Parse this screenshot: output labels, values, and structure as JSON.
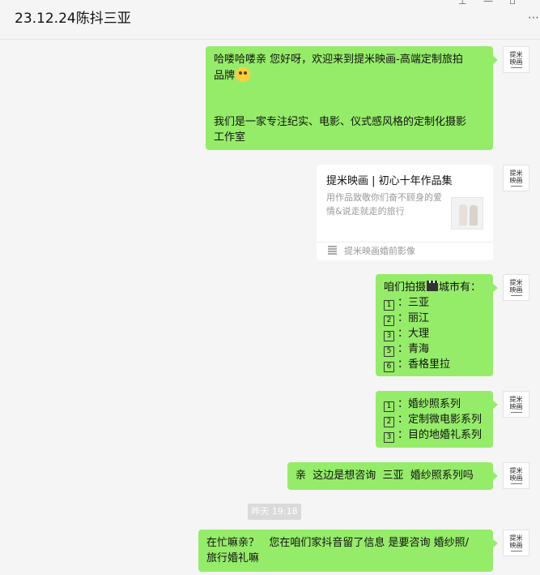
{
  "window": {
    "title": "23.12.24陈抖三亚",
    "controls": {
      "pin": "⊥",
      "minimize": "—",
      "maximize": "▫",
      "more": "⋯"
    }
  },
  "contact": {
    "avatar_text": [
      "提米",
      "映画"
    ]
  },
  "messages": [
    {
      "paragraphs": [
        "哈喽哈喽亲 您好呀，欢迎来到提米映画-高端定制旅拍",
        "品牌",
        "我们是一家专注纪实、电影、仪式感风格的定制化摄影",
        "工作室"
      ],
      "emoji": "smiling-face-emoji"
    },
    {
      "card": {
        "title": "提米映画 | 初心十年作品集",
        "desc": "用作品致敬你们奋不顾身的爱情&说走就走的旅行",
        "source": "提米映画婚前影像"
      }
    },
    {
      "header_before": "咱们拍摄",
      "header_after": "城市有：",
      "items": [
        {
          "num": "1",
          "text": "三亚"
        },
        {
          "num": "2",
          "text": "丽江"
        },
        {
          "num": "3",
          "text": "大理"
        },
        {
          "num": "5",
          "text": "青海"
        },
        {
          "num": "6",
          "text": "香格里拉"
        }
      ]
    },
    {
      "items": [
        {
          "num": "1",
          "text": "婚纱照系列"
        },
        {
          "num": "2",
          "text": "定制微电影系列"
        },
        {
          "num": "3",
          "text": "目的地婚礼系列"
        }
      ]
    },
    {
      "text": "亲  这边是想咨询  三亚  婚纱照系列吗"
    },
    {
      "timestamp": "昨天 19:18"
    },
    {
      "lines": [
        "在忙嘛亲？   您在咱们家抖音留了信息 是要咨询 婚纱照/",
        "旅行婚礼嘛"
      ]
    }
  ]
}
